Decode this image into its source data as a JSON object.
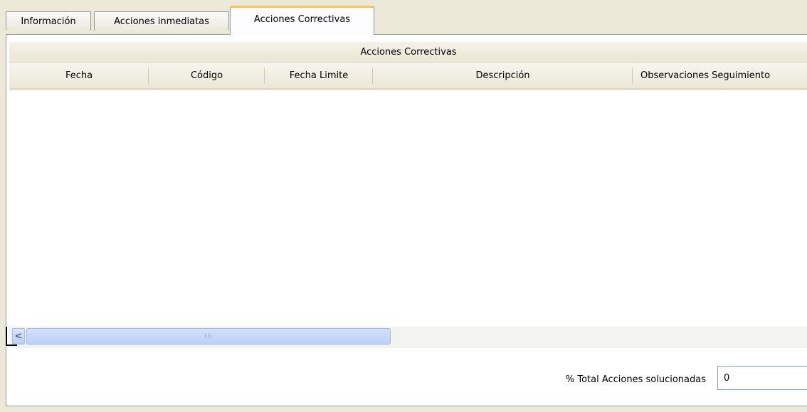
{
  "tabs": [
    {
      "label": "Información",
      "active": false
    },
    {
      "label": "Acciones inmediatas",
      "active": false
    },
    {
      "label": "Acciones Correctivas",
      "active": true
    }
  ],
  "table": {
    "group_title": "Acciones Correctivas",
    "columns": [
      "Fecha",
      "Código",
      "Fecha Limite",
      "Descripción",
      "Observaciones Seguimiento"
    ],
    "rows": []
  },
  "scrollbar": {
    "thumb_grip": "III",
    "left_arrow": "<"
  },
  "footer": {
    "total_label": "% Total Acciones solucionadas",
    "total_value": "0"
  },
  "colors": {
    "active_tab_accent": "#f6c55b",
    "background": "#ece9d8",
    "scroll_thumb": "#c4d5f9"
  }
}
